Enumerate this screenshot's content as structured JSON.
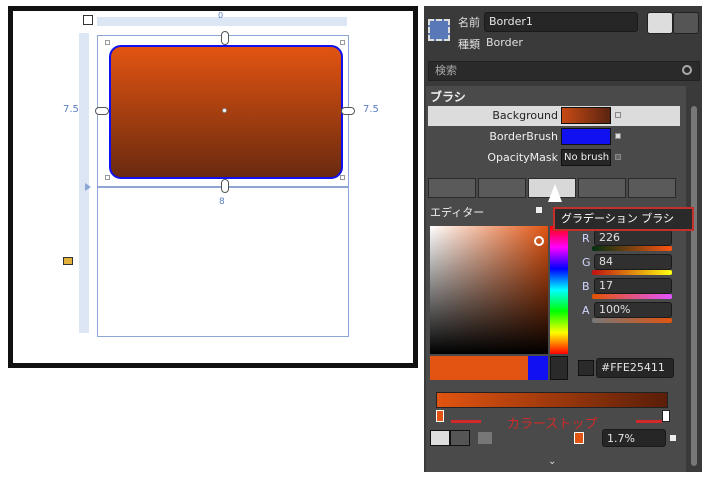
{
  "canvas": {
    "margin_left": "7.5",
    "margin_right": "7.5",
    "margin_top": "0",
    "margin_bottom": "8"
  },
  "header": {
    "name_label": "名前",
    "name_value": "Border1",
    "type_label": "種類",
    "type_value": "Border"
  },
  "search": {
    "placeholder": "検索"
  },
  "brush": {
    "section_title": "ブラシ",
    "rows": [
      {
        "label": "Background",
        "color": "#c84a14",
        "value": ""
      },
      {
        "label": "BorderBrush",
        "color": "#1010f0",
        "value": ""
      },
      {
        "label": "OpacityMask",
        "color": "#262626",
        "value": "No brush"
      }
    ],
    "editor_tab": "エディター",
    "tooltip": "グラデーション ブラシ"
  },
  "color": {
    "R": "226",
    "G": "84",
    "B": "17",
    "A": "100%",
    "hex": "#FFE25411",
    "current": "#e25411",
    "previous": "#1010f0"
  },
  "gradient": {
    "stops_annotation": "カラーストップ",
    "offset": "1.7%"
  }
}
